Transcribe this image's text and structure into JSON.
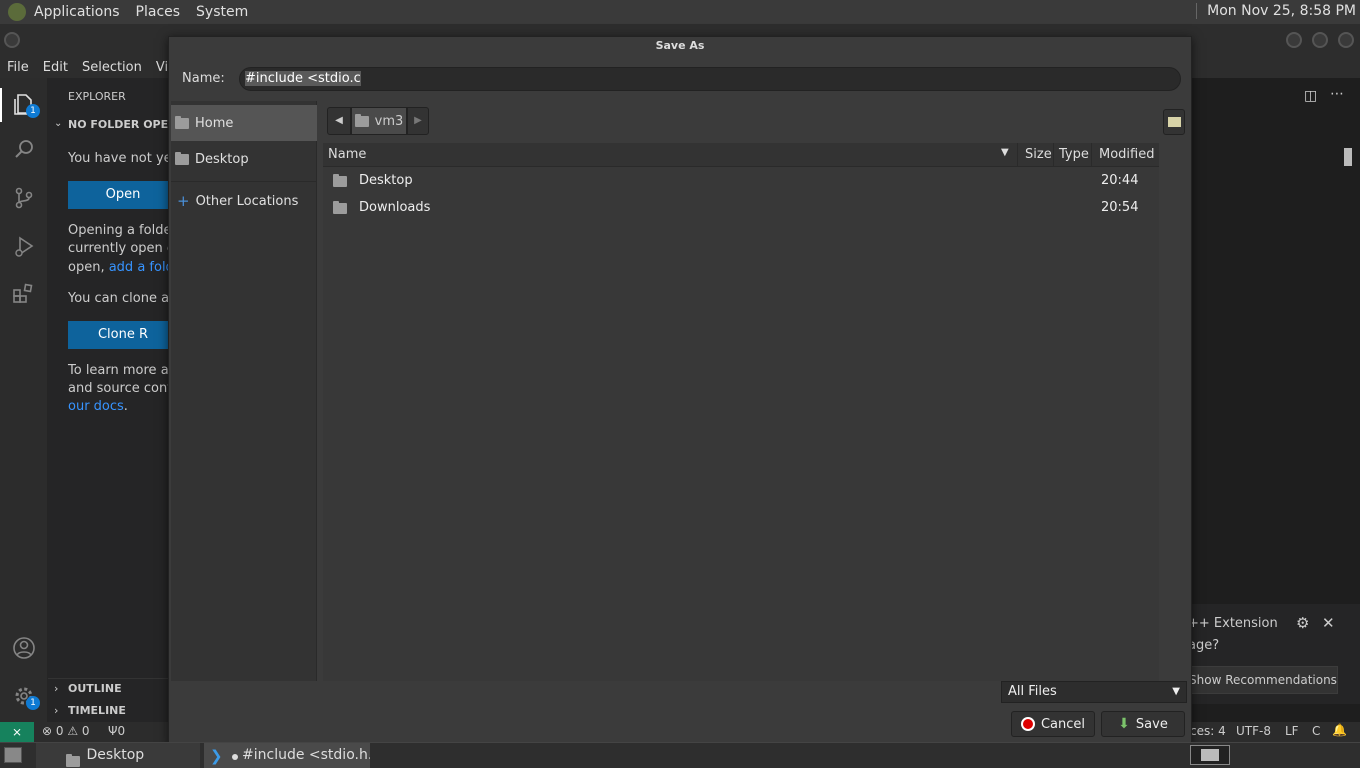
{
  "top_panel": {
    "menus": [
      "Applications",
      "Places",
      "System"
    ],
    "clock": "Mon Nov 25,  8:58 PM"
  },
  "vscode": {
    "menu": [
      "File",
      "Edit",
      "Selection",
      "View"
    ],
    "explorer_title": "EXPLORER",
    "section_title": "NO FOLDER OPENE",
    "text1": "You have not yet o",
    "open_button": "Open",
    "text2a": "Opening a folder",
    "text2b": "currently open ed",
    "text2c": "open,",
    "text2c_link": "add a folde",
    "text3": "You can clone a re",
    "clone_button": "Clone R",
    "text4a": "To learn more abo",
    "text4b": "and source contro",
    "text4c_link": "our docs",
    "text4c_end": ".",
    "outline": "OUTLINE",
    "timeline": "TIMELINE",
    "explorer_badge": "1",
    "settings_badge": "1",
    "notification": {
      "line1": "++ Extension",
      "line2": "age?",
      "button": "Show Recommendations"
    },
    "status": {
      "errors": "0",
      "warnings": "0",
      "ports": "0",
      "spaces": "ces: 4",
      "encoding": "UTF-8",
      "eol": "LF",
      "lang": "C"
    }
  },
  "dialog": {
    "title": "Save As",
    "name_label": "Name:",
    "name_value": "#include <stdio.c",
    "places": [
      {
        "label": "Home",
        "selected": true
      },
      {
        "label": "Desktop",
        "selected": false
      },
      {
        "label": "Other Locations",
        "selected": false
      }
    ],
    "path_segment": "vm3",
    "columns": {
      "name": "Name",
      "size": "Size",
      "type": "Type",
      "modified": "Modified"
    },
    "rows": [
      {
        "name": "Desktop",
        "size": "",
        "type": "",
        "modified": "20:44"
      },
      {
        "name": "Downloads",
        "size": "",
        "type": "",
        "modified": "20:54"
      }
    ],
    "filter": "All Files",
    "cancel": "Cancel",
    "save": "Save"
  },
  "taskbar": {
    "desktop": "Desktop",
    "window": "#include <stdio.h..."
  }
}
